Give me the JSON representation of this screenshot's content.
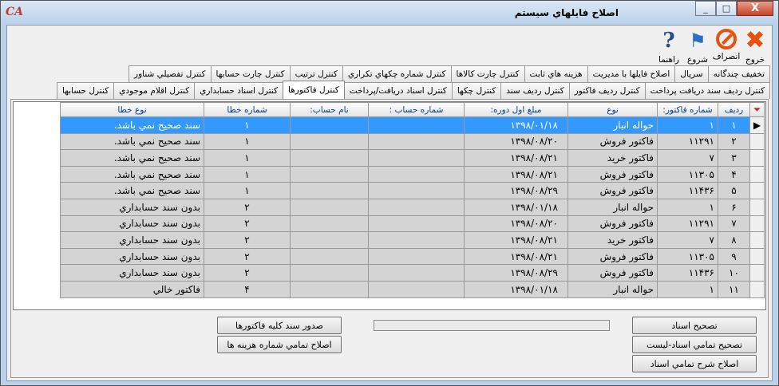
{
  "window": {
    "title": "اصلاح فايلهاي سيستم",
    "app_icon_text": "CA",
    "minimize": "_",
    "maximize": "□",
    "close": "X"
  },
  "toolbar": {
    "exit": {
      "label": "خروج",
      "icon": "close-x-icon"
    },
    "cancel": {
      "label": "انصراف",
      "icon": "no-entry-icon"
    },
    "start": {
      "label": "شروع",
      "icon": "flag-icon"
    },
    "help": {
      "label": "راهنما",
      "icon": "question-icon"
    }
  },
  "tabs_row1": [
    "تخفيف چندگانه",
    "سرپال",
    "اصلاح فايلها با مديريت",
    "هزينه هاي ثابت",
    "کنترل چارت کالاها",
    "کنترل شماره چکهاي تکراري",
    "کنترل ترتيب",
    "کنترل چارت حسابها",
    "کنترل تفصيلي شناور"
  ],
  "tabs_row2": [
    "کنترل رديف سند دريافت پرداخت",
    "کنترل رديف فاکتور",
    "کنترل رديف سند",
    "کنترل چکها",
    "کنترل اسناد دريافت/پرداخت",
    "کنترل فاکتورها",
    "کنترل اسناد حسابداري",
    "کنترل اقلام موجودي",
    "کنترل حسابها"
  ],
  "active_tab": "کنترل فاکتورها",
  "grid": {
    "filter_icon": "filter-icon",
    "columns": [
      "رديف",
      "شماره فاکتور:",
      "نوع",
      "مبلغ اول دوره:",
      "شماره حساب :",
      "نام حساب:",
      "شماره خطا",
      "نوع خطا"
    ],
    "selected_row": 0,
    "row_indicator": "▶",
    "rows": [
      [
        "١",
        "١",
        "حواله انبار",
        "١٣٩٨/٠١/١٨",
        "",
        "",
        "١",
        "سند صحيح نمي باشد."
      ],
      [
        "٢",
        "١١٢٩١",
        "فاکتور فروش",
        "١٣٩٨/٠٨/٢٠",
        "",
        "",
        "١",
        "سند صحيح نمي باشد."
      ],
      [
        "٣",
        "٧",
        "فاکتور خريد",
        "١٣٩٨/٠٨/٢١",
        "",
        "",
        "١",
        "سند صحيح نمي باشد."
      ],
      [
        "۴",
        "١١٣٠۵",
        "فاکتور فروش",
        "١٣٩٨/٠٨/٢١",
        "",
        "",
        "١",
        "سند صحيح نمي باشد."
      ],
      [
        "۵",
        "١١۴٣۶",
        "فاکتور فروش",
        "١٣٩٨/٠٨/٢٩",
        "",
        "",
        "١",
        "سند صحيح نمي باشد."
      ],
      [
        "۶",
        "١",
        "حواله انبار",
        "١٣٩٨/٠١/١٨",
        "",
        "",
        "٢",
        "بدون سند حسابداري"
      ],
      [
        "٧",
        "١١٢٩١",
        "فاکتور فروش",
        "١٣٩٨/٠٨/٢٠",
        "",
        "",
        "٢",
        "بدون سند حسابداري"
      ],
      [
        "٨",
        "٧",
        "فاکتور خريد",
        "١٣٩٨/٠٨/٢١",
        "",
        "",
        "٢",
        "بدون سند حسابداري"
      ],
      [
        "٩",
        "١١٣٠۵",
        "فاکتور فروش",
        "١٣٩٨/٠٨/٢١",
        "",
        "",
        "٢",
        "بدون سند حسابداري"
      ],
      [
        "١٠",
        "١١۴٣۶",
        "فاکتور فروش",
        "١٣٩٨/٠٨/٢٩",
        "",
        "",
        "٢",
        "بدون سند حسابداري"
      ],
      [
        "١١",
        "١",
        "حواله انبار",
        "١٣٩٨/٠١/١٨",
        "",
        "",
        "۴",
        "فاکتور خالي"
      ]
    ]
  },
  "buttons": {
    "issue_all_invoices": "صدور سند کليه فاکتورها",
    "fix_expense_numbers": "اصلاح تمامي شماره هزينه ها",
    "fix_documents": "تصحيح اسناد",
    "fix_all_documents_list": "تصحيح تمامي اسناد-ليست",
    "fix_all_descriptions": "اصلاح شرح تمامي اسناد"
  },
  "progress": {
    "value": 0
  }
}
